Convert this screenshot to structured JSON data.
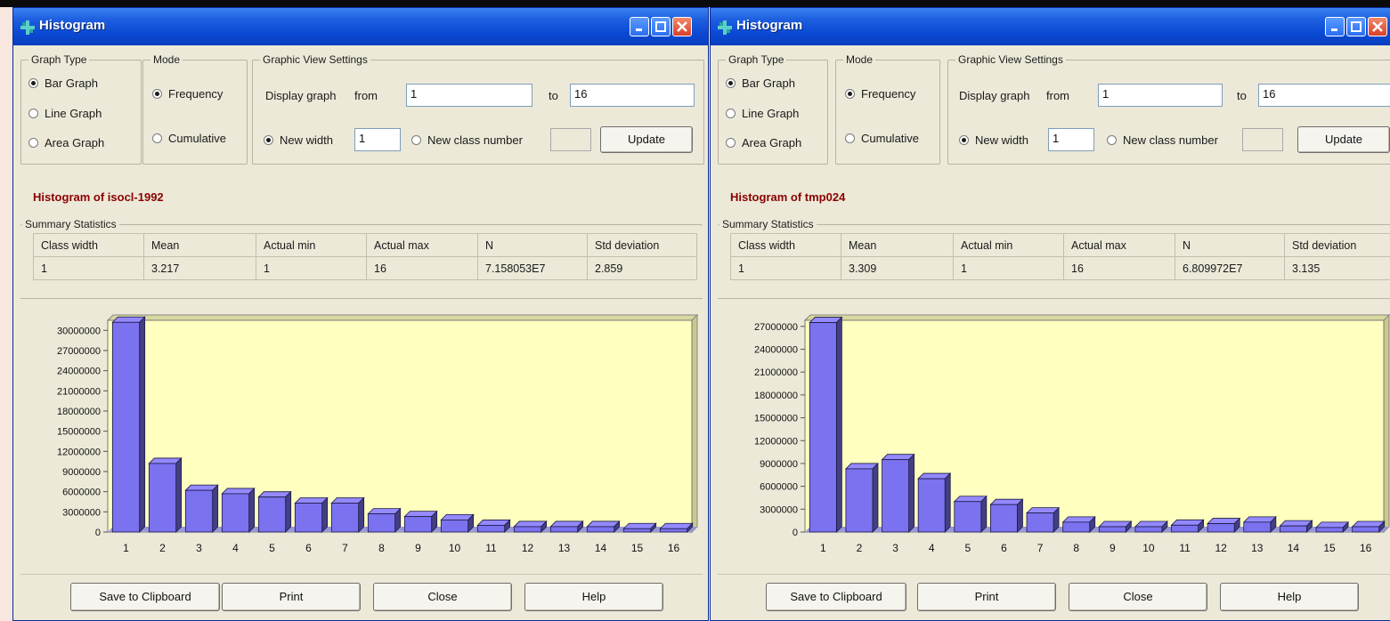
{
  "windows": [
    {
      "title": "Histogram",
      "graph_type": {
        "legend": "Graph Type",
        "options": [
          {
            "label": "Bar Graph",
            "selected": true
          },
          {
            "label": "Line Graph",
            "selected": false
          },
          {
            "label": "Area Graph",
            "selected": false
          }
        ]
      },
      "mode": {
        "legend": "Mode",
        "options": [
          {
            "label": "Frequency",
            "selected": true
          },
          {
            "label": "Cumulative",
            "selected": false
          }
        ]
      },
      "view_settings": {
        "legend": "Graphic View Settings",
        "display_label": "Display graph",
        "from_label": "from",
        "from_value": "1",
        "to_label": "to",
        "to_value": "16",
        "new_width_label": "New width",
        "new_width_selected": true,
        "new_width_value": "1",
        "new_class_label": "New class number",
        "new_class_selected": false,
        "new_class_value": "",
        "update_label": "Update"
      },
      "histogram_title": "Histogram of isocl-1992",
      "summary": {
        "legend": "Summary Statistics",
        "headers": [
          "Class width",
          "Mean",
          "Actual min",
          "Actual max",
          "N",
          "Std deviation"
        ],
        "values": [
          "1",
          "3.217",
          "1",
          "16",
          "7.158053E7",
          "2.859"
        ]
      },
      "buttons": {
        "save": "Save to Clipboard",
        "print": "Print",
        "close": "Close",
        "help": "Help"
      },
      "chart_data": {
        "type": "bar",
        "title": "",
        "xlabel": "",
        "ylabel": "",
        "categories": [
          "1",
          "2",
          "3",
          "4",
          "5",
          "6",
          "7",
          "8",
          "9",
          "10",
          "11",
          "12",
          "13",
          "14",
          "15",
          "16"
        ],
        "values": [
          31200000,
          10200000,
          6200000,
          5700000,
          5200000,
          4300000,
          4300000,
          2700000,
          2300000,
          1800000,
          1000000,
          800000,
          800000,
          800000,
          500000,
          500000
        ],
        "ylim": [
          0,
          31500000
        ],
        "yticks": [
          "0",
          "3000000",
          "6000000",
          "9000000",
          "12000000",
          "15000000",
          "18000000",
          "21000000",
          "24000000",
          "27000000",
          "30000000"
        ],
        "bar_color": "#7b72f0",
        "background_color": "#ffffc0",
        "grid": false
      }
    },
    {
      "title": "Histogram",
      "graph_type": {
        "legend": "Graph Type",
        "options": [
          {
            "label": "Bar Graph",
            "selected": true
          },
          {
            "label": "Line Graph",
            "selected": false
          },
          {
            "label": "Area Graph",
            "selected": false
          }
        ]
      },
      "mode": {
        "legend": "Mode",
        "options": [
          {
            "label": "Frequency",
            "selected": true
          },
          {
            "label": "Cumulative",
            "selected": false
          }
        ]
      },
      "view_settings": {
        "legend": "Graphic View Settings",
        "display_label": "Display graph",
        "from_label": "from",
        "from_value": "1",
        "to_label": "to",
        "to_value": "16",
        "new_width_label": "New width",
        "new_width_selected": true,
        "new_width_value": "1",
        "new_class_label": "New class number",
        "new_class_selected": false,
        "new_class_value": "",
        "update_label": "Update"
      },
      "histogram_title": "Histogram of tmp024",
      "summary": {
        "legend": "Summary Statistics",
        "headers": [
          "Class width",
          "Mean",
          "Actual min",
          "Actual max",
          "N",
          "Std deviation"
        ],
        "values": [
          "1",
          "3.309",
          "1",
          "16",
          "6.809972E7",
          "3.135"
        ]
      },
      "buttons": {
        "save": "Save to Clipboard",
        "print": "Print",
        "close": "Close",
        "help": "Help"
      },
      "chart_data": {
        "type": "bar",
        "title": "",
        "xlabel": "",
        "ylabel": "",
        "categories": [
          "1",
          "2",
          "3",
          "4",
          "5",
          "6",
          "7",
          "8",
          "9",
          "10",
          "11",
          "12",
          "13",
          "14",
          "15",
          "16"
        ],
        "values": [
          27500000,
          8300000,
          9500000,
          7000000,
          4000000,
          3600000,
          2500000,
          1300000,
          700000,
          700000,
          900000,
          1100000,
          1300000,
          800000,
          600000,
          700000
        ],
        "ylim": [
          0,
          27800000
        ],
        "yticks": [
          "0",
          "3000000",
          "6000000",
          "9000000",
          "12000000",
          "15000000",
          "18000000",
          "21000000",
          "24000000",
          "27000000"
        ],
        "bar_color": "#7b72f0",
        "background_color": "#ffffc0",
        "grid": false
      }
    }
  ]
}
